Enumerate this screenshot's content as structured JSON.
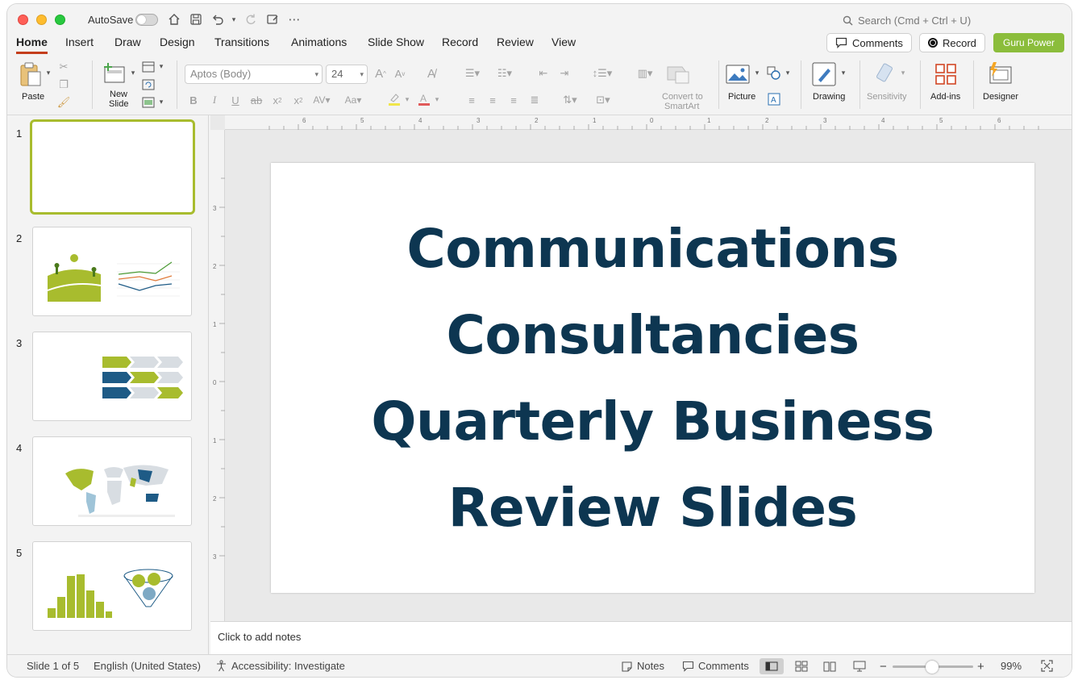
{
  "titlebar": {
    "autosave_label": "AutoSave",
    "search_placeholder": "Search (Cmd + Ctrl + U)"
  },
  "tabs": [
    "Home",
    "Insert",
    "Draw",
    "Design",
    "Transitions",
    "Animations",
    "Slide Show",
    "Record",
    "Review",
    "View"
  ],
  "active_tab": "Home",
  "actions": {
    "comments": "Comments",
    "record": "Record",
    "guru": "Guru Power"
  },
  "ribbon": {
    "paste": "Paste",
    "new_slide_1": "New",
    "new_slide_2": "Slide",
    "font_name": "Aptos (Body)",
    "font_size": "24",
    "convert_1": "Convert to",
    "convert_2": "SmartArt",
    "picture": "Picture",
    "drawing": "Drawing",
    "sensitivity": "Sensitivity",
    "addins": "Add-ins",
    "designer": "Designer"
  },
  "thumbnails": [
    {
      "num": "1"
    },
    {
      "num": "2"
    },
    {
      "num": "3"
    },
    {
      "num": "4"
    },
    {
      "num": "5"
    }
  ],
  "slide": {
    "line1": "Communications",
    "line2": "Consultancies",
    "line3": "Quarterly Business",
    "line4": "Review Slides"
  },
  "notes_placeholder": "Click to add notes",
  "status": {
    "slide_count": "Slide 1 of 5",
    "language": "English (United States)",
    "accessibility": "Accessibility: Investigate",
    "notes": "Notes",
    "comments": "Comments",
    "zoom": "99%"
  },
  "colors": {
    "accent_tab": "#c43e1c",
    "guru_green": "#8bbd3b",
    "title_navy": "#0d3651",
    "selection_border": "#a8bc2e"
  }
}
